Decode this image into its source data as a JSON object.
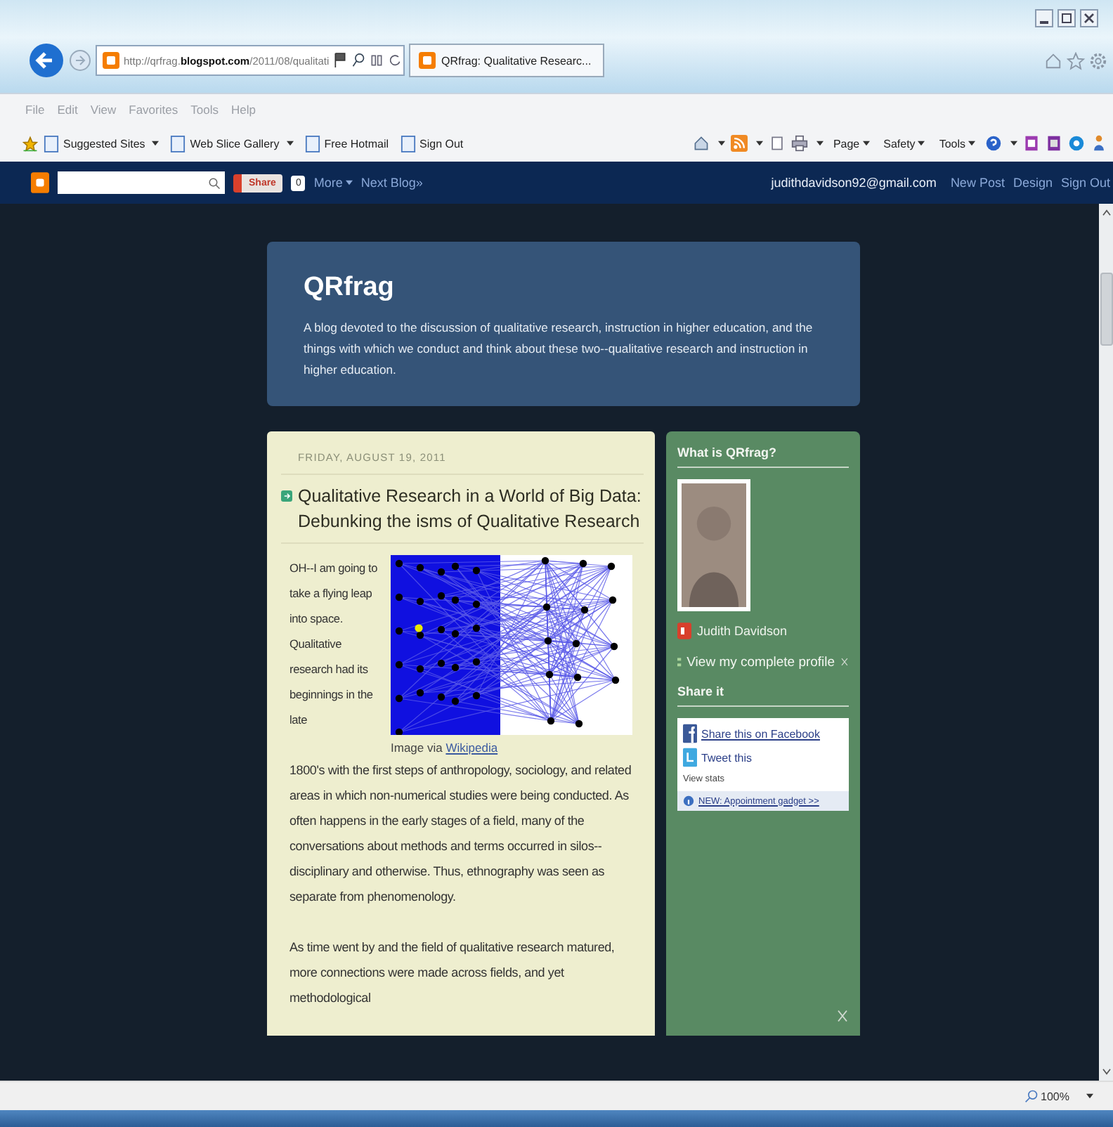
{
  "browser": {
    "address": {
      "url": "http://qrfrag.**blogspot.com**/2011/08/qualitati"
    },
    "tabs": [
      {
        "title": "QRfrag: Qualitative Researc...",
        "selected": true
      }
    ],
    "menu_bar": [
      "File",
      "Edit",
      "View",
      "Favorites",
      "Tools",
      "Help"
    ],
    "favorites": [
      {
        "label": "Suggested Sites",
        "dropdown": true
      },
      {
        "label": "Web Slice Gallery",
        "dropdown": true
      },
      {
        "label": "Free Hotmail",
        "dropdown": false
      },
      {
        "label": "Sign Out",
        "dropdown": false
      }
    ],
    "command_bar": [
      {
        "label": "Page",
        "dropdown": true
      },
      {
        "label": "Safety",
        "dropdown": true
      },
      {
        "label": "Tools",
        "dropdown": true
      }
    ]
  },
  "navbar": {
    "share_label": "Share",
    "share_count": "0",
    "links_left": [
      {
        "label": "More",
        "dropdown": true
      },
      {
        "label": "Next Blog»",
        "dropdown": false
      }
    ],
    "account": "judithdavidson92@gmail.com",
    "links_right": [
      "New Post",
      "Design",
      "Sign Out"
    ]
  },
  "blog": {
    "title": "QRfrag",
    "description": "A blog devoted to the discussion of qualitative research, instruction in higher education, and the things with which we conduct and think about these two--qualitative research and instruction in higher education."
  },
  "post": {
    "date": "FRIDAY, AUGUST 19, 2011",
    "title": "Qualitative Research in a World of Big Data: Debunking the isms of Qualitative Research",
    "caption_prefix": "Image via",
    "caption_link": "Wikipedia",
    "intro": "OH--I am going to take a flying leap into space. Qualitative research had its beginnings in the late",
    "paragraphs": [
      "1800's with the first steps of anthropology, sociology, and related areas in which non-numerical studies were being conducted.  As often happens in the early stages of a field, many of the conversations about methods and terms occurred in silos--disciplinary and otherwise.  Thus, ethnography was seen as separate from phenomenology.",
      "As time went by and the field of qualitative research matured, more connections were made across fields, and yet methodological"
    ]
  },
  "sidebar": {
    "about_heading": "What is QRfrag?",
    "profile_name": "Judith Davidson",
    "profile_link": "View my complete profile",
    "share_heading": "Share it",
    "share_links": [
      "Share this on Facebook",
      "Tweet this"
    ],
    "stats": "View stats",
    "gadget_link": "NEW: Appointment gadget >>"
  },
  "status_bar": {
    "zoom": "100%"
  }
}
